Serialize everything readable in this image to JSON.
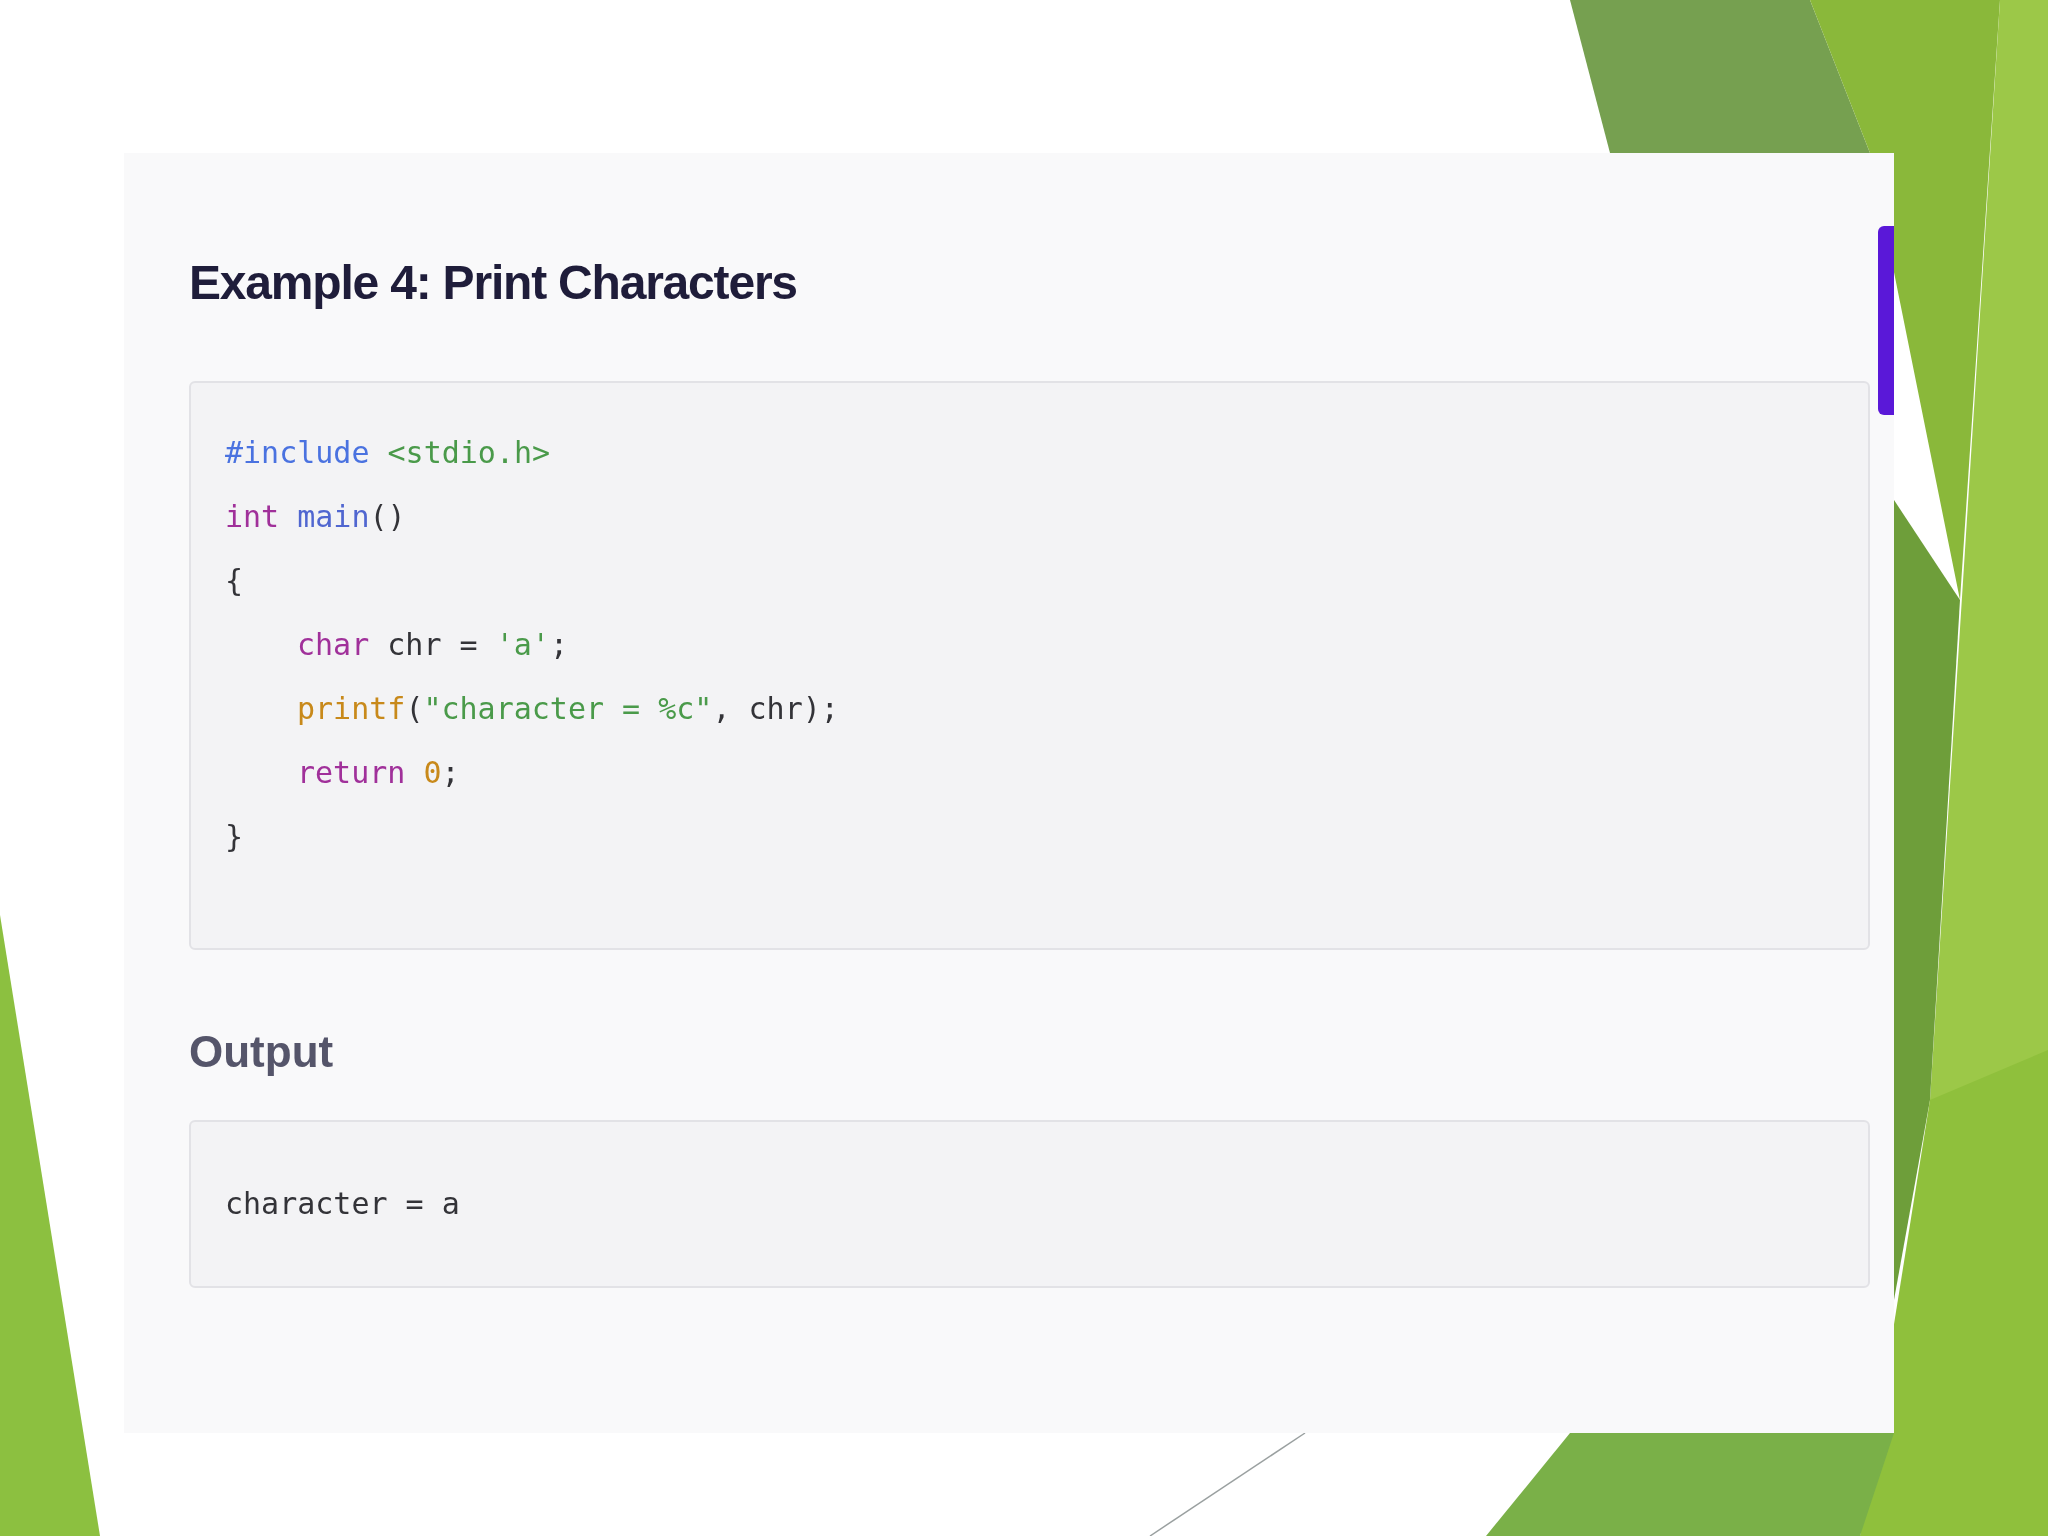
{
  "heading": "Example 4: Print Characters",
  "code": [
    {
      "indent": false,
      "tokens": [
        {
          "text": "#include",
          "kind": "directive"
        },
        {
          "text": " <stdio.h>",
          "kind": "string"
        }
      ]
    },
    {
      "indent": false,
      "tokens": [
        {
          "text": "int",
          "kind": "keyword"
        },
        {
          "text": " main",
          "kind": "function"
        },
        {
          "text": "()",
          "kind": "plain"
        }
      ]
    },
    {
      "indent": false,
      "tokens": [
        {
          "text": "{",
          "kind": "plain"
        }
      ]
    },
    {
      "indent": true,
      "tokens": [
        {
          "text": "char",
          "kind": "keyword"
        },
        {
          "text": " chr = ",
          "kind": "plain"
        },
        {
          "text": "'a'",
          "kind": "string"
        },
        {
          "text": ";",
          "kind": "plain"
        }
      ]
    },
    {
      "indent": true,
      "tokens": [
        {
          "text": "printf",
          "kind": "call"
        },
        {
          "text": "(",
          "kind": "plain"
        },
        {
          "text": "\"character = %c\"",
          "kind": "string"
        },
        {
          "text": ", chr);",
          "kind": "plain"
        }
      ]
    },
    {
      "indent": true,
      "tokens": [
        {
          "text": "return",
          "kind": "keyword"
        },
        {
          "text": " 0",
          "kind": "number"
        },
        {
          "text": ";",
          "kind": "plain"
        }
      ]
    },
    {
      "indent": false,
      "tokens": [
        {
          "text": "}",
          "kind": "plain"
        }
      ]
    }
  ],
  "output_heading": "Output",
  "output": "character = a"
}
